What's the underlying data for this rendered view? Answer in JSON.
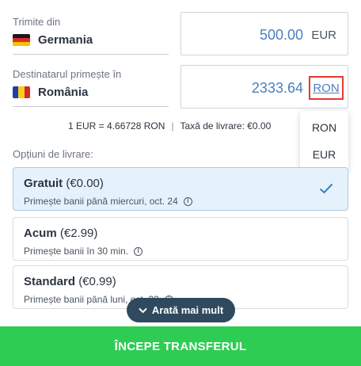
{
  "sender": {
    "label": "Trimite din",
    "country": "Germania",
    "amount": "500.00",
    "currency": "EUR"
  },
  "recipient": {
    "label": "Destinatarul primește în",
    "country": "România",
    "amount": "2333.64",
    "currency": "RON"
  },
  "currency_dropdown": {
    "options": [
      "RON",
      "EUR"
    ]
  },
  "rate_info": {
    "rate": "1 EUR = 4.66728 RON",
    "separator": "|",
    "fee": "Taxă de livrare: €0.00"
  },
  "delivery": {
    "title": "Opțiuni de livrare:",
    "options": [
      {
        "name": "Gratuit",
        "price": "(€0.00)",
        "desc": "Primește banii până miercuri, oct. 24",
        "selected": true
      },
      {
        "name": "Acum",
        "price": "(€2.99)",
        "desc": "Primește banii în 30 min.",
        "selected": false
      },
      {
        "name": "Standard",
        "price": "(€0.99)",
        "desc": "Primește banii până luni, oct. 22",
        "selected": false
      }
    ]
  },
  "show_more": {
    "label": "Arată mai mult"
  },
  "cta": {
    "label": "ÎNCEPE TRANSFERUL"
  },
  "icons": {
    "flag_germany": "germany-flag-icon",
    "flag_romania": "romania-flag-icon",
    "check": "check-icon",
    "info": "info-icon",
    "chevron": "chevron-down-icon"
  },
  "colors": {
    "accent_blue": "#4a7fc0",
    "cta_green": "#2ecc53",
    "selected_bg": "#e6f2fb",
    "highlight_red": "#e53935",
    "pill_dark": "#2f4a5e"
  }
}
